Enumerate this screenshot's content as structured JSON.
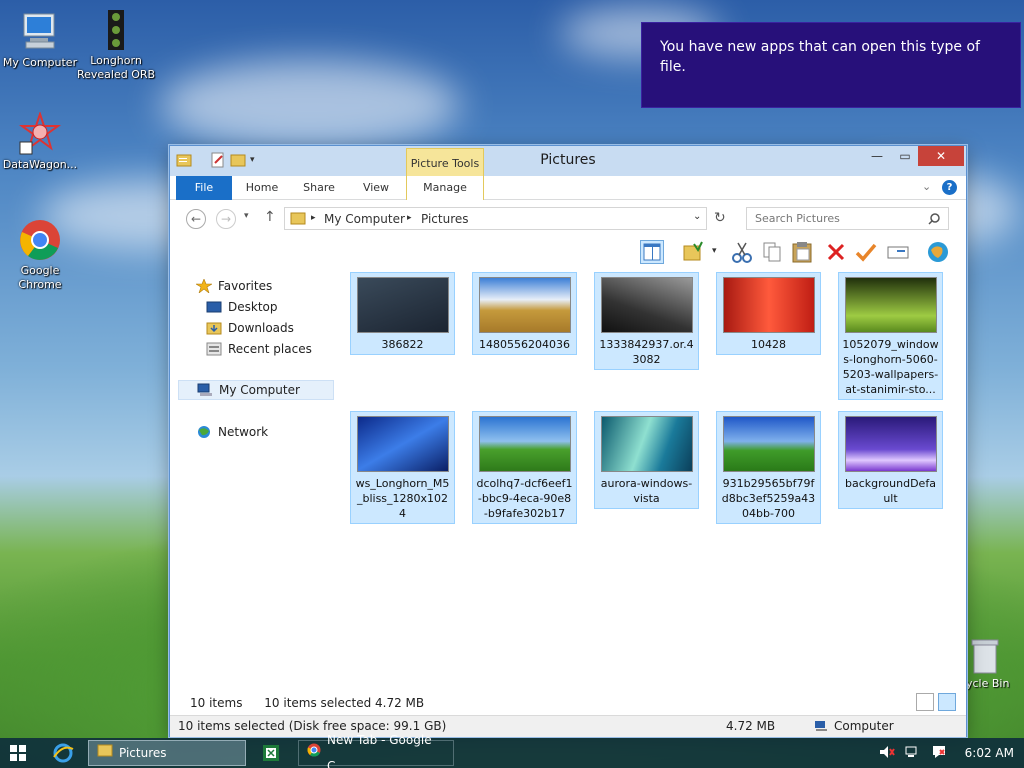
{
  "desktop": {
    "icons": [
      {
        "label": "My Computer"
      },
      {
        "label": "Longhorn Revealed ORB"
      },
      {
        "label": "DataWagon..."
      },
      {
        "label": "Google Chrome"
      }
    ],
    "recycle_label": "ycle Bin"
  },
  "toast": {
    "message": "You have new apps that can open this type of file."
  },
  "window": {
    "title": "Pictures",
    "context_tab": "Picture Tools",
    "ribbon_tabs": [
      "File",
      "Home",
      "Share",
      "View",
      "Manage"
    ],
    "address": {
      "segments": [
        "My Computer",
        "Pictures"
      ]
    },
    "search_placeholder": "Search Pictures",
    "nav": {
      "favorites": "Favorites",
      "items": [
        "Desktop",
        "Downloads",
        "Recent places"
      ],
      "computer": "My Computer",
      "network": "Network"
    },
    "files": [
      {
        "name": "386822",
        "colors": [
          "#1b2431",
          "#3a4a5a"
        ]
      },
      {
        "name": "1480556204036",
        "colors": [
          "#3d7fd6",
          "#c59a3c"
        ]
      },
      {
        "name": "1333842937.or.43082",
        "colors": [
          "#222",
          "#777"
        ]
      },
      {
        "name": "10428",
        "colors": [
          "#a81a12",
          "#ff5a3c"
        ]
      },
      {
        "name": "1052079_windows-longhorn-5060-5203-wallpapers-at-stanimir-sto...",
        "colors": [
          "#2f4d12",
          "#9ecb43"
        ]
      },
      {
        "name": "ws_Longhorn_M5_bliss_1280x1024",
        "colors": [
          "#0c2a8a",
          "#3c7de8"
        ]
      },
      {
        "name": "dcolhq7-dcf6eef1-bbc9-4eca-90e8-b9fafe302b17",
        "colors": [
          "#2b74d2",
          "#49a02c"
        ]
      },
      {
        "name": "aurora-windows-vista",
        "colors": [
          "#0b5a6e",
          "#8fe0d0"
        ]
      },
      {
        "name": "931b29565bf79fd8bc3ef5259a4304bb-700",
        "colors": [
          "#1f58c8",
          "#3f9c2a"
        ]
      },
      {
        "name": "backgroundDefault",
        "colors": [
          "#2a1a7a",
          "#b07ae8"
        ]
      }
    ],
    "status": {
      "count": "10 items",
      "selected": "10 items selected  4.72 MB"
    },
    "status_bar": {
      "left": "10 items selected (Disk free space: 99.1 GB)",
      "size": "4.72 MB",
      "location": "Computer"
    }
  },
  "taskbar": {
    "buttons": [
      {
        "label": "Pictures"
      },
      {
        "label": "New Tab - Google C..."
      }
    ],
    "clock": "6:02 AM"
  },
  "colors": {
    "accent": "#1a6fc8",
    "toast_bg": "#27107a",
    "selection": "#cce8ff"
  }
}
